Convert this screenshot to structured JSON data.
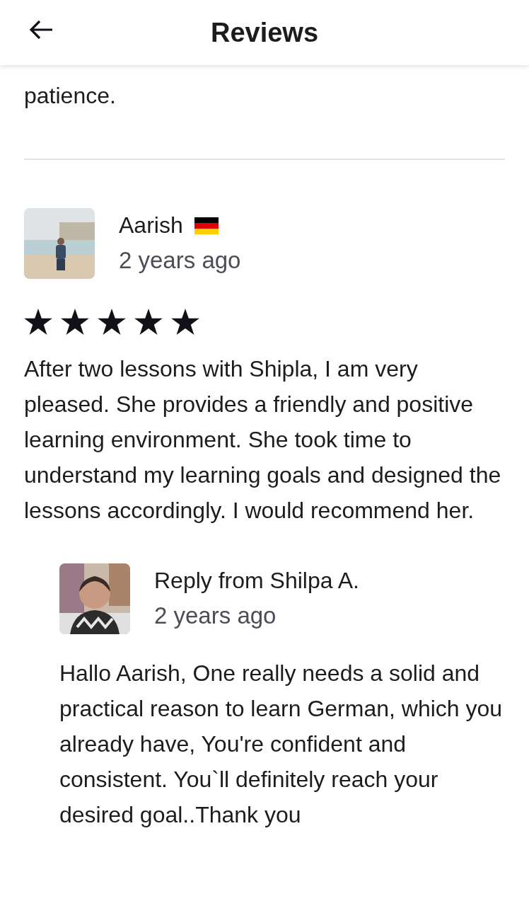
{
  "header": {
    "title": "Reviews"
  },
  "previous_review": {
    "text_tail": "patience."
  },
  "review": {
    "author": "Aarish",
    "time": "2 years ago",
    "stars": 5,
    "text": "After two lessons with Shipla, I am very pleased. She provides a friendly and positive learning environment. She took time to understand my learning goals and designed the lessons accordingly. I would recommend her.",
    "reply": {
      "author": "Reply from Shilpa A.",
      "time": "2 years ago",
      "text": "Hallo Aarish, One really needs a solid and practical reason to learn German, which you already have, You're confident and consistent. You`ll definitely reach your desired goal..Thank you"
    }
  }
}
